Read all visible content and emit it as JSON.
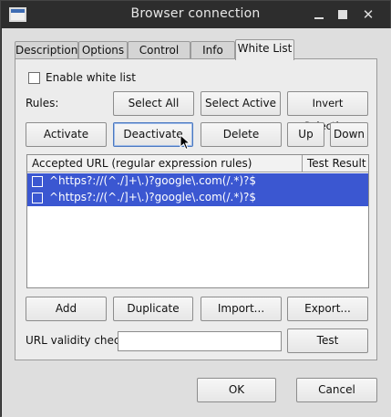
{
  "window": {
    "title": "Browser connection",
    "controls": {
      "minimize": "minimize",
      "maximize": "maximize",
      "close": "✕"
    }
  },
  "tabs": [
    {
      "label": "Description"
    },
    {
      "label": "Options"
    },
    {
      "label": "Control Bar"
    },
    {
      "label": "Info Bar"
    },
    {
      "label": "White List",
      "active": true
    }
  ],
  "whitelist": {
    "enable_label": "Enable white list",
    "enable_checked": false,
    "rules_label": "Rules:",
    "buttons_row1": {
      "select_all": "Select All",
      "select_active": "Select Active",
      "invert_selection": "Invert Selection"
    },
    "buttons_row2": {
      "activate": "Activate",
      "deactivate": "Deactivate",
      "delete": "Delete",
      "up": "Up",
      "down": "Down"
    },
    "table": {
      "headers": [
        "Accepted URL (regular expression rules)",
        "Test Result"
      ],
      "rows": [
        {
          "checked": false,
          "url": "^https?://(^./]+\\.)?google\\.com(/.*)?$",
          "test_result": ""
        },
        {
          "checked": false,
          "url": "^https?://(^./]+\\.)?google\\.com(/.*)?$",
          "test_result": ""
        }
      ]
    },
    "buttons_row3": {
      "add": "Add",
      "duplicate": "Duplicate",
      "import": "Import...",
      "export": "Export..."
    },
    "url_validity_label": "URL validity check",
    "url_validity_value": "",
    "test_button": "Test"
  },
  "footer": {
    "ok": "OK",
    "cancel": "Cancel"
  },
  "colors": {
    "selection": "#3b57d1",
    "focus_border": "#4a78c0"
  }
}
